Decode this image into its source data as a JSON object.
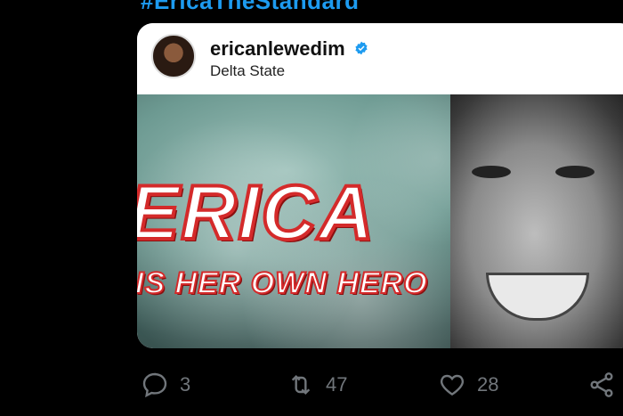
{
  "hashtag": "#EricaTheStandard",
  "card": {
    "username": "ericanlewedim",
    "location": "Delta State",
    "hero_title": "ERICA",
    "hero_subtitle": "IS HER OWN HERO"
  },
  "actions": {
    "reply_count": "3",
    "retweet_count": "47",
    "like_count": "28"
  },
  "colors": {
    "background": "#000000",
    "accent": "#1d9bf0",
    "icon": "#71767b",
    "hero_red": "#d42a2a"
  },
  "icons": [
    "verified-icon",
    "reply-icon",
    "retweet-icon",
    "like-icon",
    "share-icon"
  ]
}
